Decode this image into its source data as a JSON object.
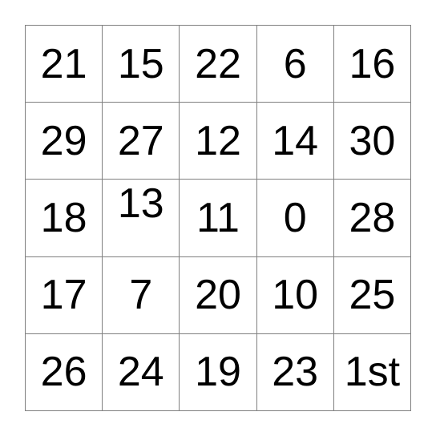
{
  "card": {
    "type": "bingo-card",
    "rows": 5,
    "columns": 5,
    "grid_line_color": "#808080",
    "text_color": "#000000",
    "background_color": "#ffffff",
    "free_space_label": "1st",
    "cells": [
      [
        {
          "label": "21",
          "align": "center"
        },
        {
          "label": "15",
          "align": "center"
        },
        {
          "label": "22",
          "align": "center"
        },
        {
          "label": "6",
          "align": "center"
        },
        {
          "label": "16",
          "align": "center"
        }
      ],
      [
        {
          "label": "29",
          "align": "center"
        },
        {
          "label": "27",
          "align": "center"
        },
        {
          "label": "12",
          "align": "center"
        },
        {
          "label": "14",
          "align": "center"
        },
        {
          "label": "30",
          "align": "center"
        }
      ],
      [
        {
          "label": "18",
          "align": "center"
        },
        {
          "label": "13",
          "align": "top"
        },
        {
          "label": "11",
          "align": "center"
        },
        {
          "label": "0",
          "align": "center"
        },
        {
          "label": "28",
          "align": "center"
        }
      ],
      [
        {
          "label": "17",
          "align": "center"
        },
        {
          "label": "7",
          "align": "center"
        },
        {
          "label": "20",
          "align": "center"
        },
        {
          "label": "10",
          "align": "center"
        },
        {
          "label": "25",
          "align": "center"
        }
      ],
      [
        {
          "label": "26",
          "align": "center"
        },
        {
          "label": "24",
          "align": "center"
        },
        {
          "label": "19",
          "align": "center"
        },
        {
          "label": "23",
          "align": "center"
        },
        {
          "label": "1st",
          "align": "center"
        }
      ]
    ]
  }
}
